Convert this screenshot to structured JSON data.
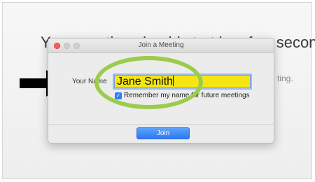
{
  "background": {
    "heading": "Your meeting should start in a few seconds...",
    "subtext": "ting."
  },
  "dialog": {
    "title": "Join a Meeting",
    "name_label": "Your Name",
    "name_value": "Jane Smith",
    "remember_label": "Remember my name for future meetings",
    "remember_checked": true,
    "join_label": "Join"
  },
  "annotations": {
    "ring_color": "#9ccc4c",
    "arrow_color": "#000000"
  },
  "colors": {
    "input_highlight": "#f6e510",
    "primary_button": "#2d78f3",
    "close_button": "#fc5b57"
  }
}
